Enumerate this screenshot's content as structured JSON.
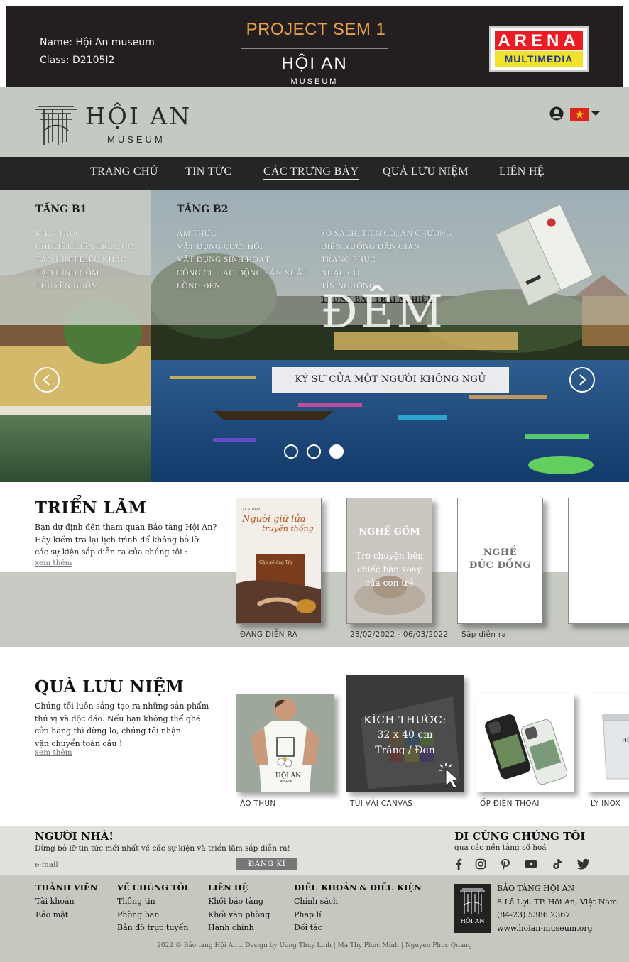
{
  "banner": {
    "student_name": "Name: Hội An museum",
    "student_class": "Class: D2105I2",
    "project": "PROJECT SEM 1",
    "logo_title": "HỘI AN",
    "logo_subtitle": "MUSEUM",
    "partner_line1": "ARENA",
    "partner_line2": "MULTIMEDIA"
  },
  "header": {
    "logo_title": "HỘI AN",
    "logo_subtitle": "MUSEUM",
    "user_icon": "user-icon",
    "language_flag": "vietnam-flag-icon"
  },
  "nav": {
    "items": [
      "TRANG CHỦ",
      "TIN TỨC",
      "CÁC TRƯNG BÀY",
      "QUÀ LƯU NIỆM",
      "LIÊN HỆ"
    ],
    "active": "CÁC TRƯNG BÀY"
  },
  "mega_menu": {
    "floor_b1": {
      "title": "TẦNG B1",
      "items": [
        "KIẾN TRÚC",
        "CHI TIẾT KIẾN TRÚC GỖ",
        "TẠO HÌNH ĐIÊU KHẮC",
        "TẠO HÌNH GỐM",
        "THUYỀN BUỒM"
      ]
    },
    "floor_b2": {
      "title": "TẦNG B2",
      "col1": [
        "ẨM THỰC",
        "VẬT DỤNG CƯỚI HỎI",
        "VẬT DỤNG SINH HOẠT",
        "CÔNG CỤ LAO ĐỘNG SẢN XUẤT",
        "LỒNG ĐÈN"
      ],
      "col2": [
        "SỔ SÁCH, TIỀN CỔ, ẤN CHƯƠNG",
        "DIỄN XƯỚNG DÂN GIAN",
        "TRANG PHỤC",
        "NHẠC CỤ",
        "TÍN NGƯỠNG",
        "TRƯNG BÀY TRẢI NGHIỆM"
      ]
    }
  },
  "hero": {
    "overlay_text": "ĐÊM",
    "caption": "KÝ SỰ CỦA MỘT NGƯỜI KHÔNG NGỦ",
    "active_slide": 3,
    "slide_count": 3
  },
  "exhibitions": {
    "title": "TRIỂN LÃM",
    "description": [
      "Bạn dự định đến tham quan Bảo tàng Hội An?",
      "Hãy kiểm tra lại lịch trình để không bỏ lỡ",
      "các sự kiện sắp diễn ra của chúng tôi :"
    ],
    "more": "xem thêm",
    "poster1": {
      "date": "21.2.2022",
      "title_line1": "Người giữ lửa",
      "title_line2": "truyền thống",
      "book_title": "Gặp gỡ ông Tây"
    },
    "poster2": {
      "title": "NGHỀ GỐM",
      "lines": [
        "Trò chuyện bên",
        "chiếc bàn xoay",
        "của con trẻ"
      ]
    },
    "poster3": {
      "lines": [
        "NGHỀ",
        "ĐÚC ĐỒNG"
      ]
    },
    "labels": [
      "ĐANG DIỄN RA",
      "28/02/2022 - 06/03/2022",
      "Sắp diễn ra"
    ]
  },
  "souvenirs": {
    "title": "QUÀ LƯU NIỆM",
    "description": [
      "Chúng tôi luôn sáng tạo ra những sản phẩm",
      "thú vị và độc đáo. Nếu bạn không thể ghé",
      "cửa hàng thì đừng lo, chúng tôi nhận",
      "vận chuyển toàn cầu !"
    ],
    "more": "xem thêm",
    "tshirt_brand": "HỘI AN",
    "tshirt_sub": "MUSEUM",
    "canvas_overlay": {
      "heading": "KÍCH THƯỚC:",
      "size": "32 x 40 cm",
      "colors": "Trắng / Đen"
    },
    "cup_text": "HỘI",
    "labels": [
      "ÁO THUN",
      "TÚI VẢI CANVAS",
      "ỐP ĐIỆN THOẠI",
      "LY INOX"
    ]
  },
  "newsletter": {
    "title": "NGƯỜI NHÀ!",
    "description": "Đừng bỏ lỡ tin tức mới nhất về các sự kiện và triển lãm sắp diễn ra!",
    "email_placeholder": "e-mail",
    "subscribe": "ĐĂNG KÍ",
    "follow_title": "ĐI CÙNG CHÚNG TÔI",
    "follow_desc": "qua các nền tảng số hoá",
    "social_icons": [
      "facebook-icon",
      "instagram-icon",
      "pinterest-icon",
      "youtube-icon",
      "tiktok-icon",
      "twitter-icon"
    ]
  },
  "footer": {
    "columns": [
      {
        "title": "THÀNH VIÊN",
        "links": [
          "Tài khoản",
          "Bảo mật"
        ]
      },
      {
        "title": "VỀ CHÚNG TÔI",
        "links": [
          "Thông tin",
          "Phòng ban",
          "Bản đồ trực tuyến"
        ]
      },
      {
        "title": "LIÊN HỆ",
        "links": [
          "Khối bảo tàng",
          "Khối văn phòng",
          "Hành chính"
        ]
      },
      {
        "title": "ĐIỀU KHOẢN & ĐIỀU KIỆN",
        "links": [
          "Chính sách",
          "Pháp lí",
          "Đối tác"
        ]
      }
    ],
    "logo_text": "HỘI AN",
    "org_name": "BẢO TÀNG HỘI AN",
    "address": "8 Lê Lợi, TP. Hội An, Việt Nam",
    "phone": "(84-23) 5386 2367",
    "website": "www.hoian-museum.org",
    "copyright": "2022 © Bảo tàng Hội An .. Design by  Uong Thuy Linh  |  Ma Thy Phuc Minh  |  Nguyen Phuc Quang"
  },
  "colors": {
    "banner_bg": "#231f20",
    "accent_orange": "#e7a14a",
    "header_bg": "#c4c9c1",
    "nav_bg": "#252526",
    "band_bg": "#c7cac3",
    "footer_bg": "#c5c8bf"
  }
}
